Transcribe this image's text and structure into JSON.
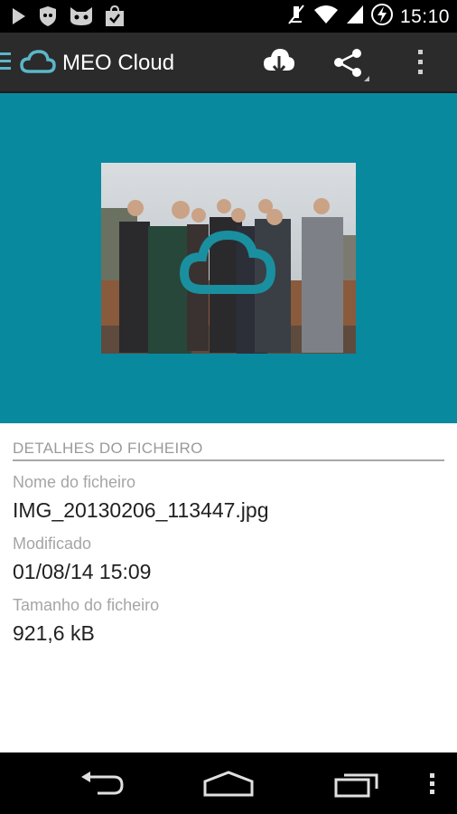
{
  "status_bar": {
    "time": "15:10",
    "left_icons": [
      "play-store-icon",
      "shield-icon",
      "cat-mask-icon",
      "shopping-bag-icon"
    ],
    "right_icons": [
      "mute-icon",
      "wifi-icon",
      "signal-icon",
      "battery-charging-icon"
    ]
  },
  "action_bar": {
    "title": "MEO Cloud",
    "icons": [
      "menu-icon",
      "cloud-logo-icon",
      "cloud-download-icon",
      "share-icon",
      "overflow-menu-icon"
    ]
  },
  "preview": {
    "background_color": "#09899e",
    "image_description_icon": "photo-thumbnail"
  },
  "details": {
    "section_title": "DETALHES DO FICHEIRO",
    "filename_label": "Nome do ficheiro",
    "filename_value": "IMG_20130206_113447.jpg",
    "modified_label": "Modificado",
    "modified_value": "01/08/14 15:09",
    "size_label": "Tamanho do ficheiro",
    "size_value": "921,6 kB"
  },
  "nav_bar": {
    "icons": [
      "back-icon",
      "home-icon",
      "recent-apps-icon",
      "overflow-icon"
    ]
  },
  "colors": {
    "accent": "#09899e",
    "action_bar": "#2b2b2b",
    "logo": "#5bb7c9"
  }
}
